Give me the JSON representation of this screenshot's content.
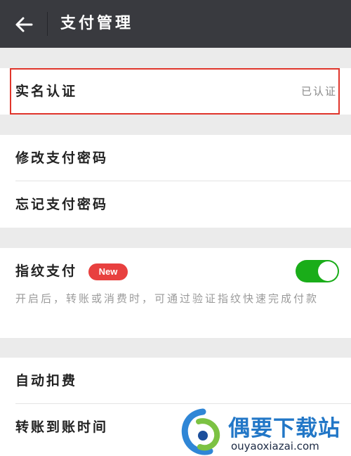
{
  "header": {
    "title": "支付管理"
  },
  "sections": {
    "verify": {
      "label": "实名认证",
      "value": "已认证"
    },
    "password": {
      "change_label": "修改支付密码",
      "forgot_label": "忘记支付密码"
    },
    "fingerprint": {
      "label": "指纹支付",
      "badge": "New",
      "enabled": true,
      "description": "开启后，转账或消费时，可通过验证指纹快速完成付款"
    },
    "other": {
      "auto_deduct_label": "自动扣费",
      "transfer_time_label": "转账到账时间"
    }
  },
  "watermark": {
    "name": "偶要下载站",
    "url": "ouyaoxiazai.com"
  },
  "colors": {
    "topbar": "#393a3f",
    "toggle_on": "#1aad19",
    "badge": "#e8403f",
    "highlight": "#e0352b"
  }
}
